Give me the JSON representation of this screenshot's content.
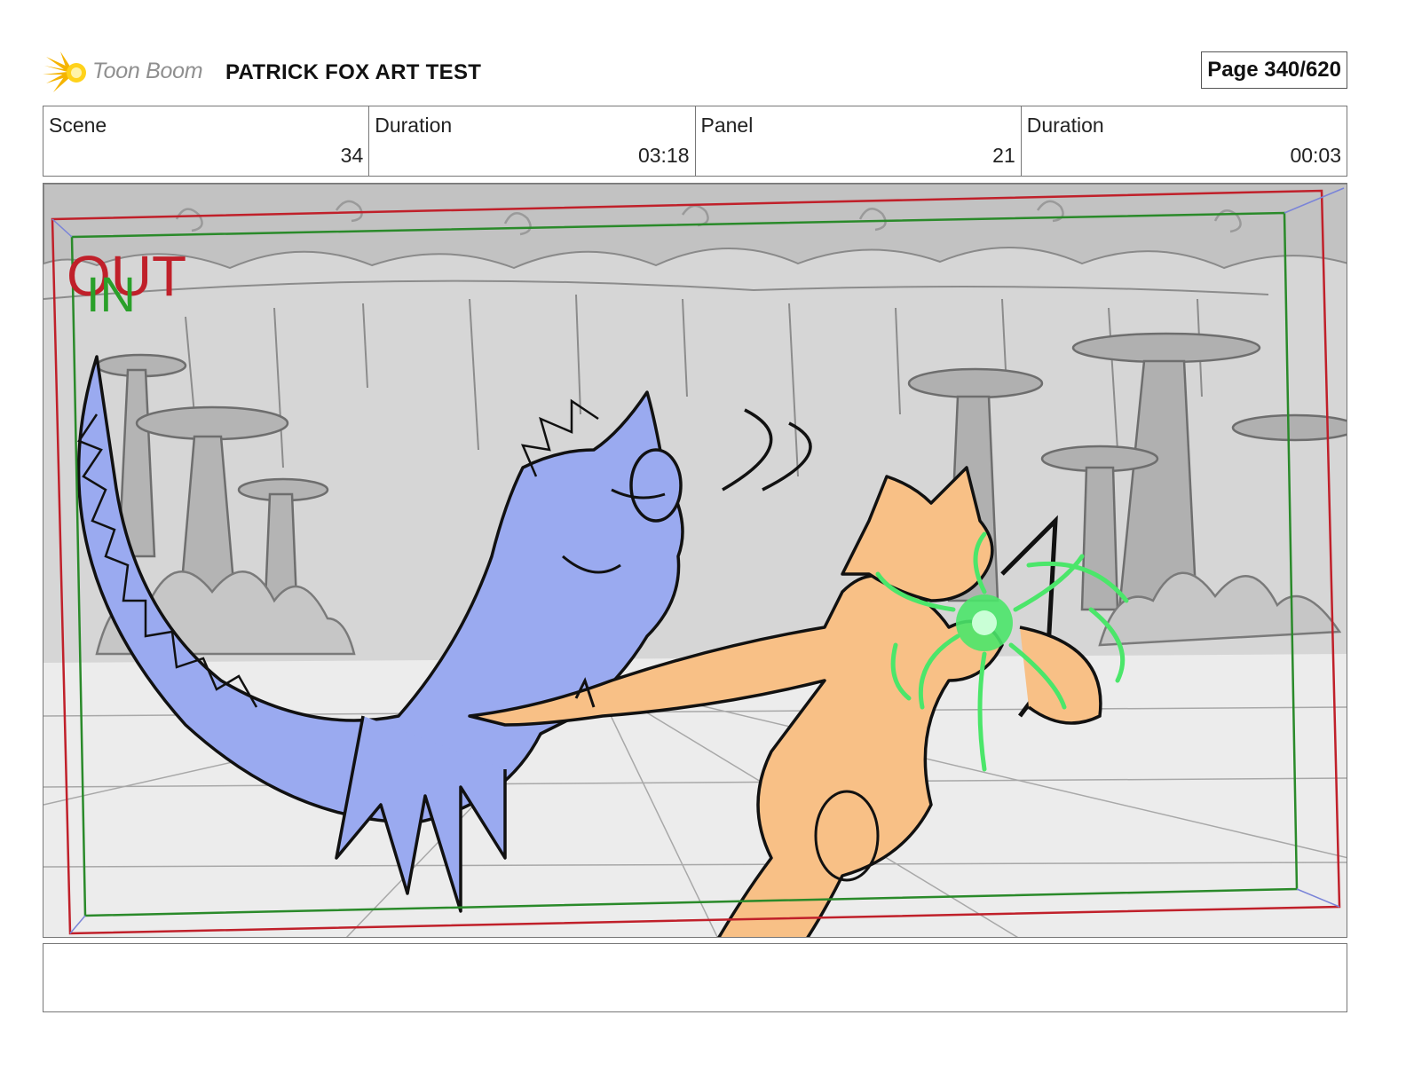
{
  "header": {
    "brand": "Toon Boom",
    "project_title": "PATRICK FOX ART TEST",
    "page": "Page 340/620"
  },
  "info": {
    "scene_label": "Scene",
    "scene_value": "34",
    "scene_duration_label": "Duration",
    "scene_duration_value": "03:18",
    "panel_label": "Panel",
    "panel_value": "21",
    "panel_duration_label": "Duration",
    "panel_duration_value": "00:03"
  },
  "panel": {
    "out_marker": "OUT",
    "in_marker": "IN",
    "colors": {
      "out_frame": "#c0202a",
      "in_frame": "#2a8a2a",
      "lizard": "#9aaaf0",
      "fox": "#f8c086",
      "energy": "#4be66a",
      "background": "#d4d4d4"
    }
  },
  "notes": {
    "text": ""
  }
}
